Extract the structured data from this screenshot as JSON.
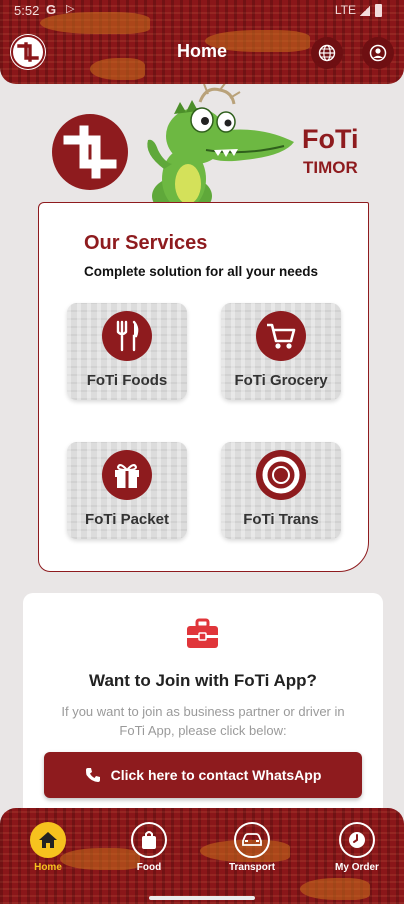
{
  "status_bar": {
    "time": "5:52",
    "g": "G",
    "network": "LTE"
  },
  "header": {
    "title": "Home",
    "globe_icon": "globe-icon",
    "account_icon": "account-circle-icon"
  },
  "brand": {
    "name": "FoTi",
    "country": "TIMOR",
    "mascot": "crocodile-mascot"
  },
  "services": {
    "title": "Our Services",
    "subtitle": "Complete solution for all your needs",
    "items": [
      {
        "label": "FoTi Foods",
        "icon": "fork-knife-icon"
      },
      {
        "label": "FoTi Grocery",
        "icon": "shopping-cart-icon"
      },
      {
        "label": "FoTi Packet",
        "icon": "gift-box-icon"
      },
      {
        "label": "FoTi Trans",
        "icon": "ring-target-icon"
      }
    ]
  },
  "join": {
    "title": "Want to Join with FoTi App?",
    "description": "If you want to join as business partner or driver in FoTi App, please click below:",
    "button_label": "Click here to contact WhatsApp",
    "icon": "briefcase-icon"
  },
  "bottom_nav": {
    "items": [
      {
        "label": "Home",
        "icon": "home-icon",
        "active": true
      },
      {
        "label": "Food",
        "icon": "shopping-bag-icon",
        "active": false
      },
      {
        "label": "Transport",
        "icon": "car-icon",
        "active": false
      },
      {
        "label": "My Order",
        "icon": "clock-icon",
        "active": false
      }
    ]
  },
  "colors": {
    "brand_red": "#8e1b1e",
    "header_red": "#8a1619",
    "active_yellow": "#f6c21e",
    "pattern_orange": "#c9701b",
    "background": "#e9e6e6"
  }
}
